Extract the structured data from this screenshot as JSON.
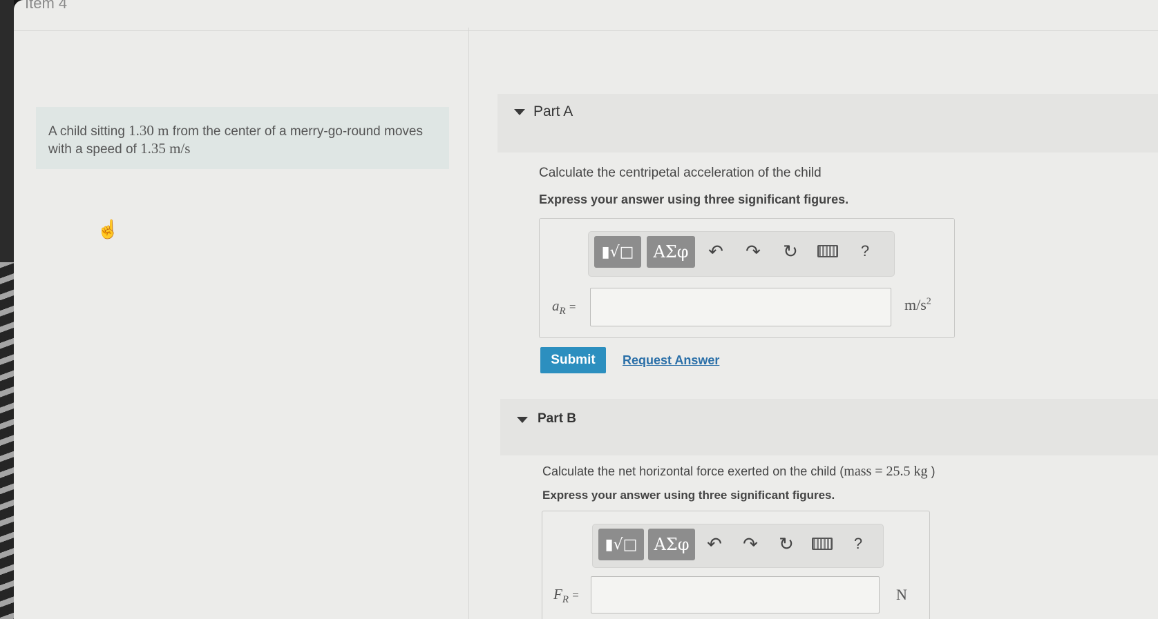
{
  "item_title": "Item 4",
  "problem": {
    "text_pre": "A child sitting ",
    "distance": "1.30 m",
    "text_mid": " from the center of a merry-go-round moves with a speed of ",
    "speed": "1.35 m/s"
  },
  "toolbar": {
    "template_label": "▮√□",
    "greek_label": "ΑΣφ",
    "undo": "↶",
    "redo": "↷",
    "reset": "↻",
    "help": "?"
  },
  "part_a": {
    "title": "Part A",
    "prompt": "Calculate the centripetal acceleration of the child",
    "instruction": "Express your answer using three significant figures.",
    "variable": "a",
    "variable_sub": "R",
    "equals": "=",
    "input_value": "",
    "unit": "m/s",
    "unit_sup": "2",
    "submit_label": "Submit",
    "request_label": "Request Answer"
  },
  "part_b": {
    "title": "Part B",
    "prompt_pre": "Calculate the net horizontal force exerted on the child  (",
    "prompt_mass": "mass = 25.5 kg",
    "prompt_post": " )",
    "instruction": "Express your answer using three significant figures.",
    "variable": "F",
    "variable_sub": "R",
    "equals": "=",
    "input_value": "",
    "unit": "N"
  }
}
